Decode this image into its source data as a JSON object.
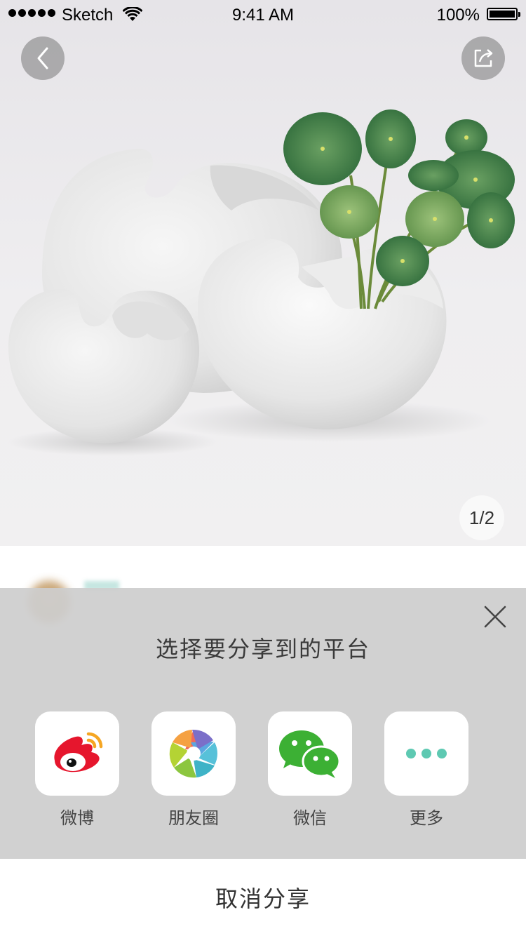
{
  "status_bar": {
    "carrier": "Sketch",
    "time": "9:41 AM",
    "battery": "100%",
    "icons": [
      "signal-dots-icon",
      "wifi-icon",
      "battery-icon"
    ]
  },
  "header": {
    "back_icon": "chevron-left-icon",
    "share_icon": "share-export-icon"
  },
  "gallery": {
    "counter": "1/2"
  },
  "share_sheet": {
    "title": "选择要分享到的平台",
    "close_icon": "close-icon",
    "platforms": [
      {
        "label": "微博",
        "icon": "weibo-icon",
        "color": "#e6162d"
      },
      {
        "label": "朋友圈",
        "icon": "moments-icon",
        "color": "#56b4e0"
      },
      {
        "label": "微信",
        "icon": "wechat-icon",
        "color": "#3cb034"
      },
      {
        "label": "更多",
        "icon": "more-dots-icon",
        "color": "#5ec9b2"
      }
    ],
    "cancel_label": "取消分享"
  }
}
